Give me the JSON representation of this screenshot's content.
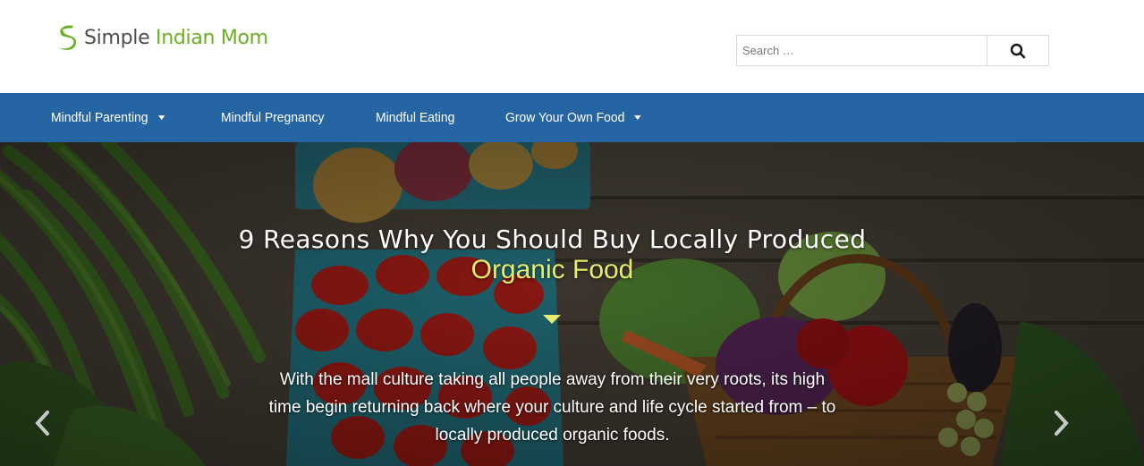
{
  "site": {
    "logo_word1": "Simple ",
    "logo_word2": "Indian Mom",
    "logo_icon": "leaf-s-logo-icon"
  },
  "search": {
    "placeholder": "Search …",
    "button_icon": "search-icon"
  },
  "nav": {
    "items": [
      {
        "label": "Mindful Parenting",
        "has_dropdown": true
      },
      {
        "label": "Mindful Pregnancy",
        "has_dropdown": false
      },
      {
        "label": "Mindful Eating",
        "has_dropdown": false
      },
      {
        "label": "Grow Your Own Food",
        "has_dropdown": true
      }
    ]
  },
  "hero": {
    "title_line1": "9 Reasons Why You Should Buy Locally Produced",
    "title_line2": "Organic Food",
    "description": "With the mall culture taking all people away from their very roots, its high time begin returning back where your culture and life cycle started from – to locally produced organic foods.",
    "prev_icon": "chevron-left-icon",
    "next_icon": "chevron-right-icon"
  },
  "colors": {
    "nav_bg": "#2665a3",
    "brand_green": "#6ab023",
    "accent_yellow": "#e6ec6e"
  }
}
